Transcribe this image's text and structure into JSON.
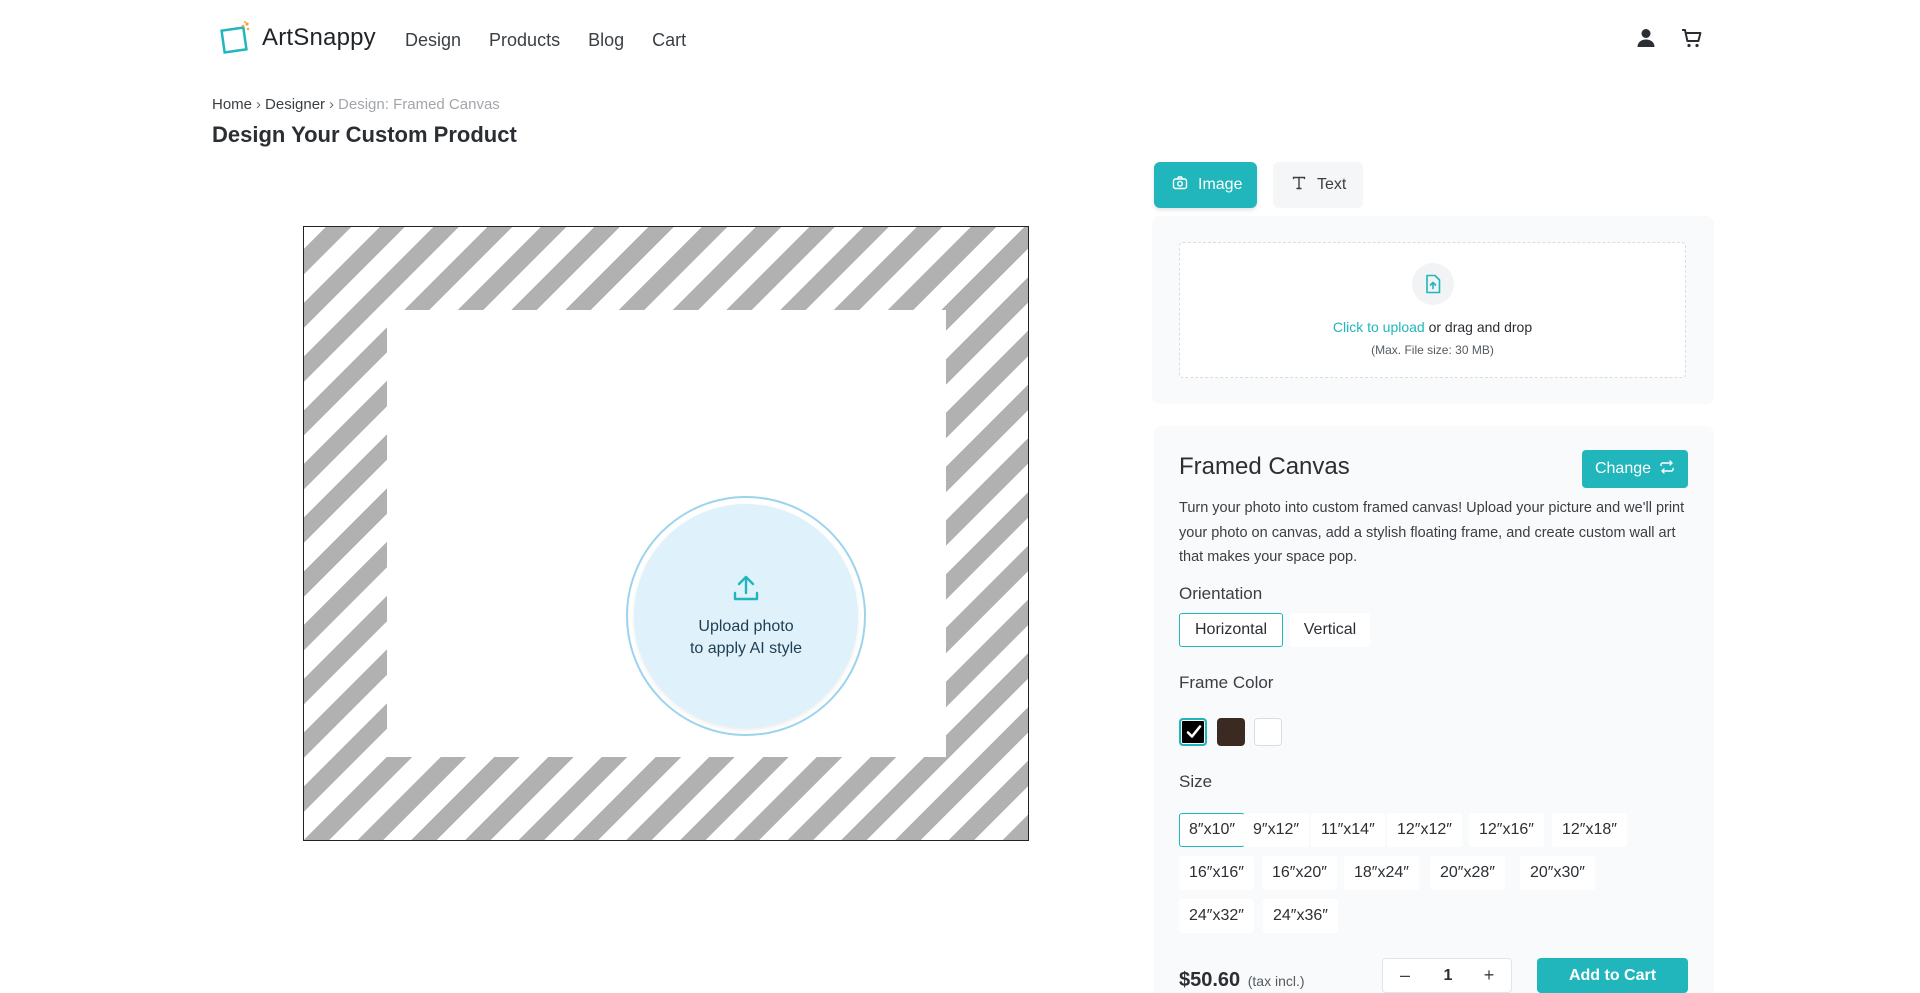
{
  "header": {
    "logo_text": "ArtSnappy",
    "nav": [
      "Design",
      "Products",
      "Blog",
      "Cart"
    ],
    "icons": [
      "user-icon",
      "cart-icon"
    ]
  },
  "breadcrumb": {
    "items": [
      "Home",
      "Designer"
    ],
    "current": "Design: Framed Canvas",
    "separator": "›"
  },
  "page_title": "Design Your Custom Product",
  "preview": {
    "upload_line1": "Upload photo",
    "upload_line2": "to apply AI style"
  },
  "tabs": [
    {
      "label": "Image",
      "icon": "camera-icon",
      "active": true
    },
    {
      "label": "Text",
      "icon": "text-icon",
      "active": false
    }
  ],
  "upload": {
    "link_text": "Click to upload",
    "rest_text": " or drag and drop",
    "max_size": "(Max. File size: 30 MB)"
  },
  "product": {
    "name": "Framed Canvas",
    "change_label": "Change",
    "description": "Turn your photo into custom framed canvas! Upload your picture and we'll print your photo on canvas, add a stylish floating frame, and create custom wall art that makes your space pop.",
    "orientation_label": "Orientation",
    "orientations": [
      "Horizontal",
      "Vertical"
    ],
    "selected_orientation": "Horizontal",
    "frame_color_label": "Frame Color",
    "frame_colors": [
      "#000000",
      "#3b2a22",
      "#ffffff"
    ],
    "selected_frame_color": "#000000",
    "size_label": "Size",
    "sizes": [
      "8″x10″",
      "9″x12″",
      "11″x14″",
      "12″x12″",
      "12″x16″",
      "12″x18″",
      "16″x16″",
      "16″x20″",
      "18″x24″",
      "20″x28″",
      "20″x30″",
      "24″x32″",
      "24″x36″"
    ],
    "selected_size": "8″x10″",
    "price": "$50.60",
    "tax_note": "(tax incl.)",
    "quantity": "1",
    "qty_minus": "–",
    "qty_plus": "+",
    "add_to_cart_label": "Add to Cart"
  },
  "colors": {
    "accent": "#21b6bb",
    "upload_circle": "#dff1fb"
  }
}
